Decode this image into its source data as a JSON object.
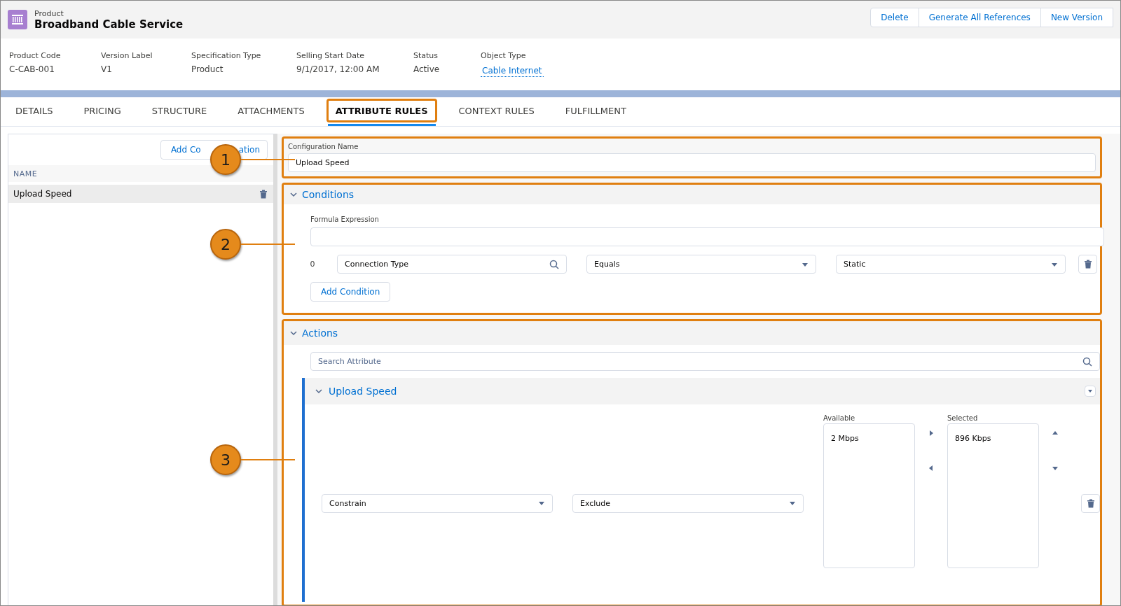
{
  "header": {
    "object_label": "Product",
    "title": "Broadband Cable Service",
    "buttons": [
      "Delete",
      "Generate All References",
      "New Version"
    ]
  },
  "fields": [
    {
      "label": "Product Code",
      "value": "C-CAB-001",
      "kind": "text"
    },
    {
      "label": "Version Label",
      "value": "V1",
      "kind": "text"
    },
    {
      "label": "Specification Type",
      "value": "Product",
      "kind": "text"
    },
    {
      "label": "Selling Start Date",
      "value": "9/1/2017, 12:00 AM",
      "kind": "text"
    },
    {
      "label": "Status",
      "value": "Active",
      "kind": "text"
    },
    {
      "label": "Object Type",
      "value": "Cable Internet",
      "kind": "link"
    }
  ],
  "tabs": [
    {
      "label": "DETAILS",
      "selected": false
    },
    {
      "label": "PRICING",
      "selected": false
    },
    {
      "label": "STRUCTURE",
      "selected": false
    },
    {
      "label": "ATTACHMENTS",
      "selected": false
    },
    {
      "label": "ATTRIBUTE RULES",
      "selected": true
    },
    {
      "label": "CONTEXT RULES",
      "selected": false
    },
    {
      "label": "FULFILLMENT",
      "selected": false
    }
  ],
  "left_panel": {
    "add_button": [
      "Add Co",
      "ation"
    ],
    "column": "NAME",
    "items": [
      {
        "label": "Upload Speed",
        "selected": true
      }
    ]
  },
  "configuration": {
    "label": "Configuration Name",
    "value": "Upload Speed"
  },
  "conditions": {
    "title": "Conditions",
    "expanded": true,
    "formula_label": "Formula Expression",
    "rows": [
      {
        "index": "0",
        "attribute": "Connection Type",
        "operator": "Equals",
        "value": "Static"
      }
    ],
    "add_button": "Add Condition"
  },
  "actions": {
    "title": "Actions",
    "expanded": true,
    "search_placeholder": "Search Attribute",
    "attributes": [
      {
        "title": "Upload Speed",
        "expanded": true,
        "action": "Constrain",
        "mode": "Exclude",
        "available_label": "Available",
        "available": [
          "2 Mbps"
        ],
        "selected_label": "Selected",
        "selected": [
          "896 Kbps"
        ]
      }
    ]
  },
  "callouts": [
    {
      "label": "1"
    },
    {
      "label": "2"
    },
    {
      "label": "3"
    }
  ]
}
